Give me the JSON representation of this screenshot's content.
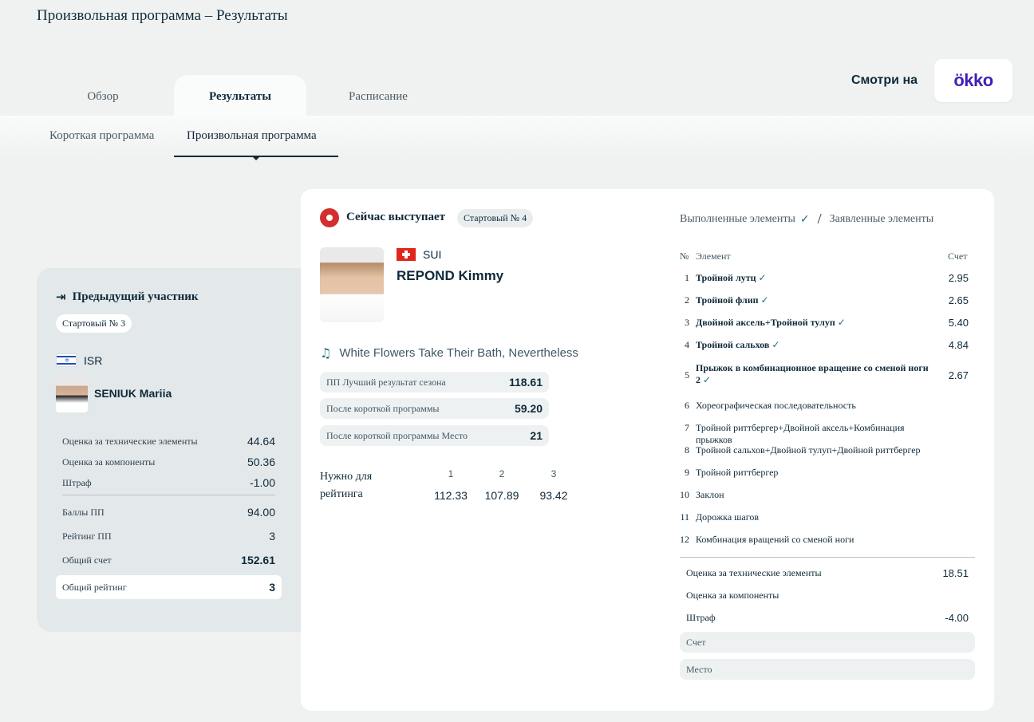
{
  "page_title": "Произвольная программа – Результаты",
  "tabs": [
    "Обзор",
    "Результаты",
    "Расписание"
  ],
  "watch_label": "Смотри на",
  "watch_logo": "ökko",
  "subtabs": [
    "Короткая программа",
    "Произвольная программа"
  ],
  "previous": {
    "title": "Предыдущий участник",
    "start": "Стартовый № 3",
    "country": "ISR",
    "name": "SENIUK Mariia",
    "rows": [
      {
        "label": "Оценка за технические элементы",
        "value": "44.64"
      },
      {
        "label": "Оценка за компоненты",
        "value": "50.36"
      },
      {
        "label": "Штраф",
        "value": "-1.00"
      },
      {
        "label": "Баллы ПП",
        "value": "94.00"
      },
      {
        "label": "Рейтинг ПП",
        "value": "3"
      },
      {
        "label": "Общий счет",
        "value": "152.61"
      },
      {
        "label": "Общий рейтинг",
        "value": "3"
      }
    ]
  },
  "current": {
    "status": "Сейчас выступает",
    "start": "Стартовый № 4",
    "country": "SUI",
    "name": "REPOND Kimmy",
    "music": "White Flowers Take Their Bath, Nevertheless",
    "stats": [
      {
        "label": "ПП Лучший результат сезона",
        "value": "118.61"
      },
      {
        "label": "После короткой программы",
        "value": "59.20"
      },
      {
        "label": "После короткой программы Место",
        "value": "21"
      }
    ],
    "need_label": "Нужно для рейтинга",
    "need": [
      {
        "place": "1",
        "value": "112.33"
      },
      {
        "place": "2",
        "value": "107.89"
      },
      {
        "place": "3",
        "value": "93.42"
      }
    ]
  },
  "elements": {
    "performed_label": "Выполненные элементы",
    "planned_label": "Заявленные элементы",
    "col_no": "№",
    "col_element": "Элемент",
    "col_score": "Счет",
    "rows": [
      {
        "no": "1",
        "name": "Тройной лутц",
        "done": true,
        "score": "2.95"
      },
      {
        "no": "2",
        "name": "Тройной флип",
        "done": true,
        "score": "2.65"
      },
      {
        "no": "3",
        "name": "Двойной аксель+Тройной тулуп",
        "done": true,
        "score": "5.40"
      },
      {
        "no": "4",
        "name": "Тройной сальхов",
        "done": true,
        "score": "4.84"
      },
      {
        "no": "5",
        "name": "Прыжок в комбинационное вращение со сменой ноги 2",
        "done": true,
        "score": "2.67"
      },
      {
        "no": "6",
        "name": "Хореографическая последовательность",
        "done": false,
        "score": ""
      },
      {
        "no": "7",
        "name": "Тройной риттбергер+Двойной аксель+Комбинация прыжков",
        "done": false,
        "score": ""
      },
      {
        "no": "8",
        "name": "Тройной сальхов+Двойной тулуп+Двойной риттбергер",
        "done": false,
        "score": ""
      },
      {
        "no": "9",
        "name": "Тройной риттбергер",
        "done": false,
        "score": ""
      },
      {
        "no": "10",
        "name": "Заклон",
        "done": false,
        "score": ""
      },
      {
        "no": "11",
        "name": "Дорожка шагов",
        "done": false,
        "score": ""
      },
      {
        "no": "12",
        "name": "Комбинация вращений со сменой ноги",
        "done": false,
        "score": ""
      }
    ],
    "summary": [
      {
        "label": "Оценка за технические элементы",
        "value": "18.51"
      },
      {
        "label": "Оценка за компоненты",
        "value": ""
      },
      {
        "label": "Штраф",
        "value": "-4.00"
      },
      {
        "label": "Счет",
        "value": ""
      },
      {
        "label": "Место",
        "value": ""
      }
    ]
  }
}
